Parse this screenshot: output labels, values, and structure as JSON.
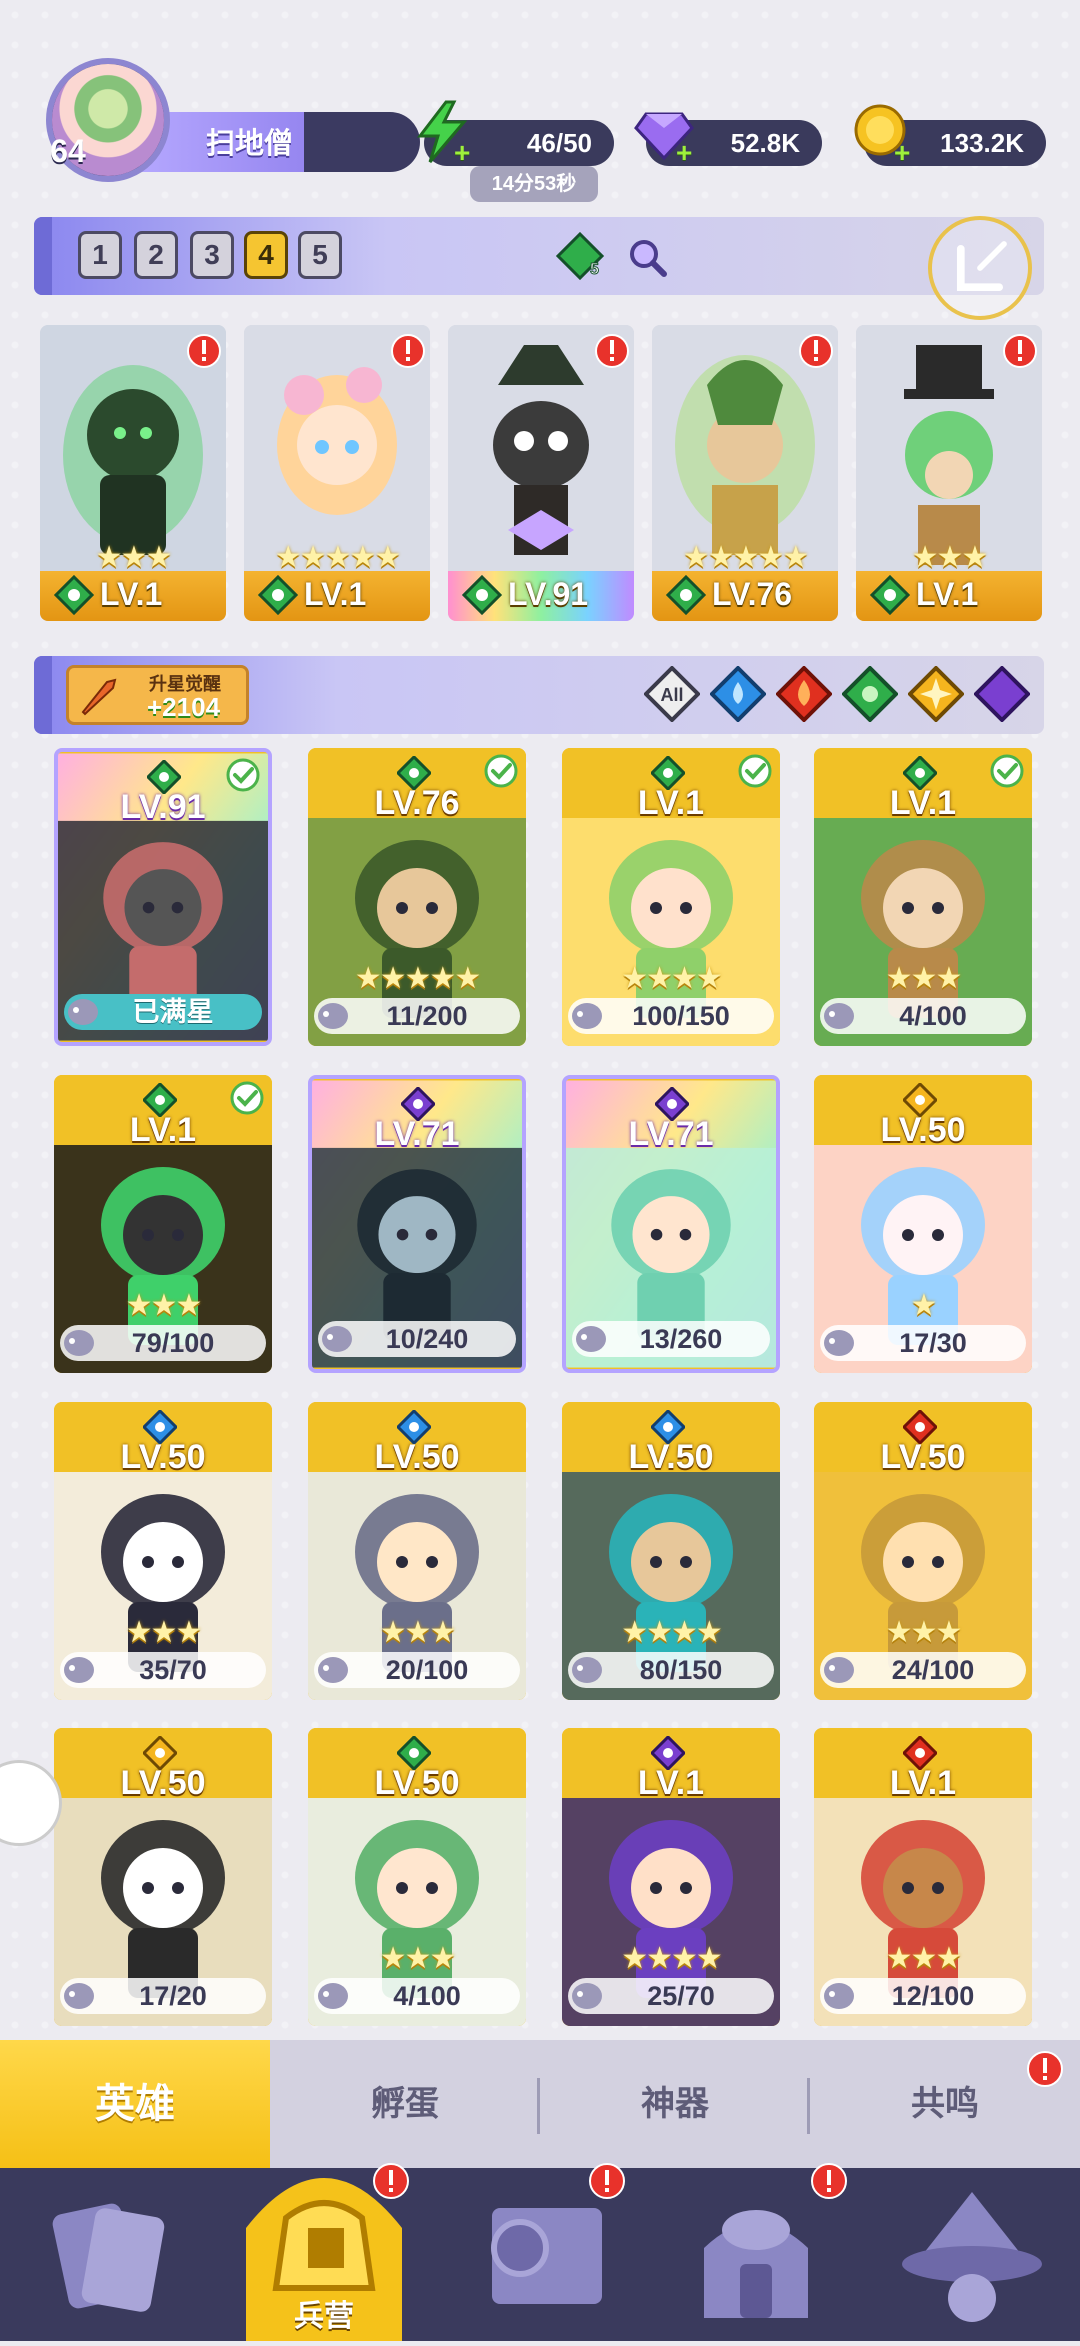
{
  "player": {
    "level": "64",
    "name": "扫地僧"
  },
  "resources": {
    "energy": "46/50",
    "energy_timer": "14分53秒",
    "gems": "52.8K",
    "gold": "133.2K"
  },
  "team": {
    "slots": [
      "1",
      "2",
      "3",
      "4",
      "5"
    ],
    "active_slot": "4",
    "gem_count": "5",
    "cards": [
      {
        "level": "LV.1",
        "stars": "★★★",
        "element": "green",
        "alert": true
      },
      {
        "level": "LV.1",
        "stars": "★★★★★",
        "element": "green",
        "alert": true
      },
      {
        "level": "LV.91",
        "stars": "",
        "element": "green",
        "alert": true
      },
      {
        "level": "LV.76",
        "stars": "★★★★★",
        "element": "green",
        "alert": true
      },
      {
        "level": "LV.1",
        "stars": "★★★",
        "element": "green",
        "alert": true
      }
    ]
  },
  "awaken": {
    "label": "升星觉醒",
    "value": "+2104"
  },
  "filters": {
    "all_label": "All",
    "elements": [
      "water",
      "fire",
      "wind",
      "light",
      "dark"
    ]
  },
  "heroes": [
    {
      "level": "LV.91",
      "element": "green",
      "check": true,
      "progress": "已满星",
      "full": true,
      "rainbow": true,
      "stars": ""
    },
    {
      "level": "LV.76",
      "element": "green",
      "check": true,
      "progress": "11/200",
      "stars": "★★★★★"
    },
    {
      "level": "LV.1",
      "element": "green",
      "check": true,
      "progress": "100/150",
      "stars": "★★★★"
    },
    {
      "level": "LV.1",
      "element": "green",
      "check": true,
      "progress": "4/100",
      "stars": "★★★"
    },
    {
      "level": "LV.1",
      "element": "green",
      "check": true,
      "progress": "79/100",
      "stars": "★★★"
    },
    {
      "level": "LV.71",
      "element": "dark",
      "check": false,
      "progress": "10/240",
      "rainbow": true,
      "stars": ""
    },
    {
      "level": "LV.71",
      "element": "dark",
      "check": false,
      "progress": "13/260",
      "rainbow": true,
      "stars": ""
    },
    {
      "level": "LV.50",
      "element": "light",
      "check": false,
      "progress": "17/30",
      "stars": "★"
    },
    {
      "level": "LV.50",
      "element": "water",
      "check": false,
      "progress": "35/70",
      "stars": "★★★"
    },
    {
      "level": "LV.50",
      "element": "water",
      "check": false,
      "progress": "20/100",
      "stars": "★★★"
    },
    {
      "level": "LV.50",
      "element": "water",
      "check": false,
      "progress": "80/150",
      "stars": "★★★★"
    },
    {
      "level": "LV.50",
      "element": "fire",
      "check": false,
      "progress": "24/100",
      "stars": "★★★"
    },
    {
      "level": "LV.50",
      "element": "light",
      "check": false,
      "progress": "17/20",
      "stars": ""
    },
    {
      "level": "LV.50",
      "element": "green",
      "check": false,
      "progress": "4/100",
      "stars": "★★★"
    },
    {
      "level": "LV.1",
      "element": "dark",
      "check": false,
      "progress": "25/70",
      "stars": "★★★★"
    },
    {
      "level": "LV.1",
      "element": "fire",
      "check": false,
      "progress": "12/100",
      "stars": "★★★"
    }
  ],
  "tabs": [
    "英雄",
    "孵蛋",
    "神器",
    "共鸣"
  ],
  "nav": {
    "active_label": "兵营"
  },
  "colors": {
    "accent": "#f5bf14",
    "nav_bg": "#3a3a5d",
    "tab_bg": "#d3d1e0"
  }
}
